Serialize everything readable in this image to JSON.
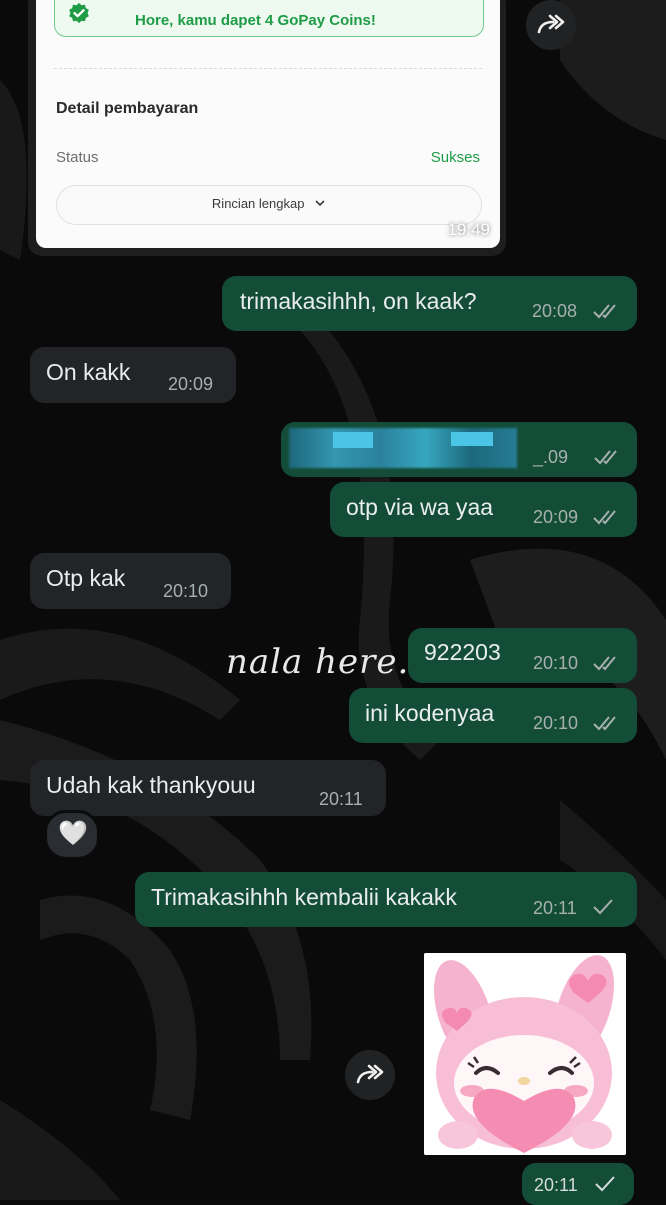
{
  "payment_card": {
    "coins_banner": "Hore, kamu dapet 4 GoPay Coins!",
    "section_title": "Detail pembayaran",
    "status_label": "Status",
    "status_value": "Sukses",
    "details_button": "Rincian lengkap",
    "time": "19:49"
  },
  "messages": [
    {
      "direction": "outgoing",
      "text": "trimakasihhh, on kaak?",
      "time": "20:08",
      "status": "read"
    },
    {
      "direction": "incoming",
      "text": "On kakk",
      "time": "20:09"
    },
    {
      "direction": "outgoing",
      "text": "",
      "time": "_.09",
      "status": "read",
      "redacted": true
    },
    {
      "direction": "outgoing",
      "text": "otp via wa yaa",
      "time": "20:09",
      "status": "read"
    },
    {
      "direction": "incoming",
      "text": "Otp kak",
      "time": "20:10"
    },
    {
      "direction": "outgoing",
      "text": "922203",
      "time": "20:10",
      "status": "read"
    },
    {
      "direction": "outgoing",
      "text": "ini kodenyaa",
      "time": "20:10",
      "status": "read"
    },
    {
      "direction": "incoming",
      "text": "Udah kak thankyouu",
      "time": "20:11",
      "reaction": "🤍"
    },
    {
      "direction": "outgoing",
      "text": "Trimakasihhh kembalii kakakk",
      "time": "20:11",
      "status": "sent"
    },
    {
      "direction": "outgoing",
      "type": "sticker",
      "time": "20:11",
      "status": "sent"
    }
  ],
  "watermark": "nala here.",
  "colors": {
    "outgoing_bubble": "#144d37",
    "incoming_bubble": "#222428",
    "background": "#0b0b0b",
    "gopay_green": "#1f9c46"
  },
  "icons": {
    "forward": "forward-arrow-icon",
    "read": "double-check-icon",
    "sent": "single-check-icon",
    "verified": "verified-check-icon",
    "chevron": "chevron-down-icon"
  }
}
